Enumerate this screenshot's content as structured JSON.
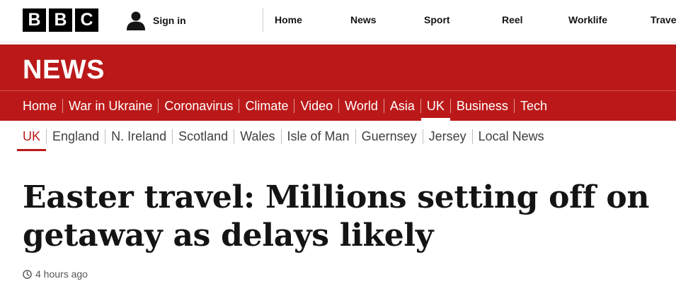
{
  "topbar": {
    "logo_letters": [
      "B",
      "B",
      "C"
    ],
    "signin_icon": "user-icon",
    "signin_label": "Sign in",
    "nav": [
      "Home",
      "News",
      "Sport",
      "Reel",
      "Worklife",
      "Travel"
    ]
  },
  "news_band": {
    "title": "NEWS",
    "primary_nav": [
      "Home",
      "War in Ukraine",
      "Coronavirus",
      "Climate",
      "Video",
      "World",
      "Asia",
      "UK",
      "Business",
      "Tech"
    ],
    "primary_active": "UK"
  },
  "secondary_nav": {
    "items": [
      "UK",
      "England",
      "N. Ireland",
      "Scotland",
      "Wales",
      "Isle of Man",
      "Guernsey",
      "Jersey",
      "Local News"
    ],
    "active": "UK"
  },
  "article": {
    "headline": "Easter travel: Millions setting off on getaway as delays likely",
    "timestamp_icon": "clock-icon",
    "timestamp": "4 hours ago"
  },
  "colors": {
    "brand_red": "#bb1919",
    "text": "#141414"
  }
}
